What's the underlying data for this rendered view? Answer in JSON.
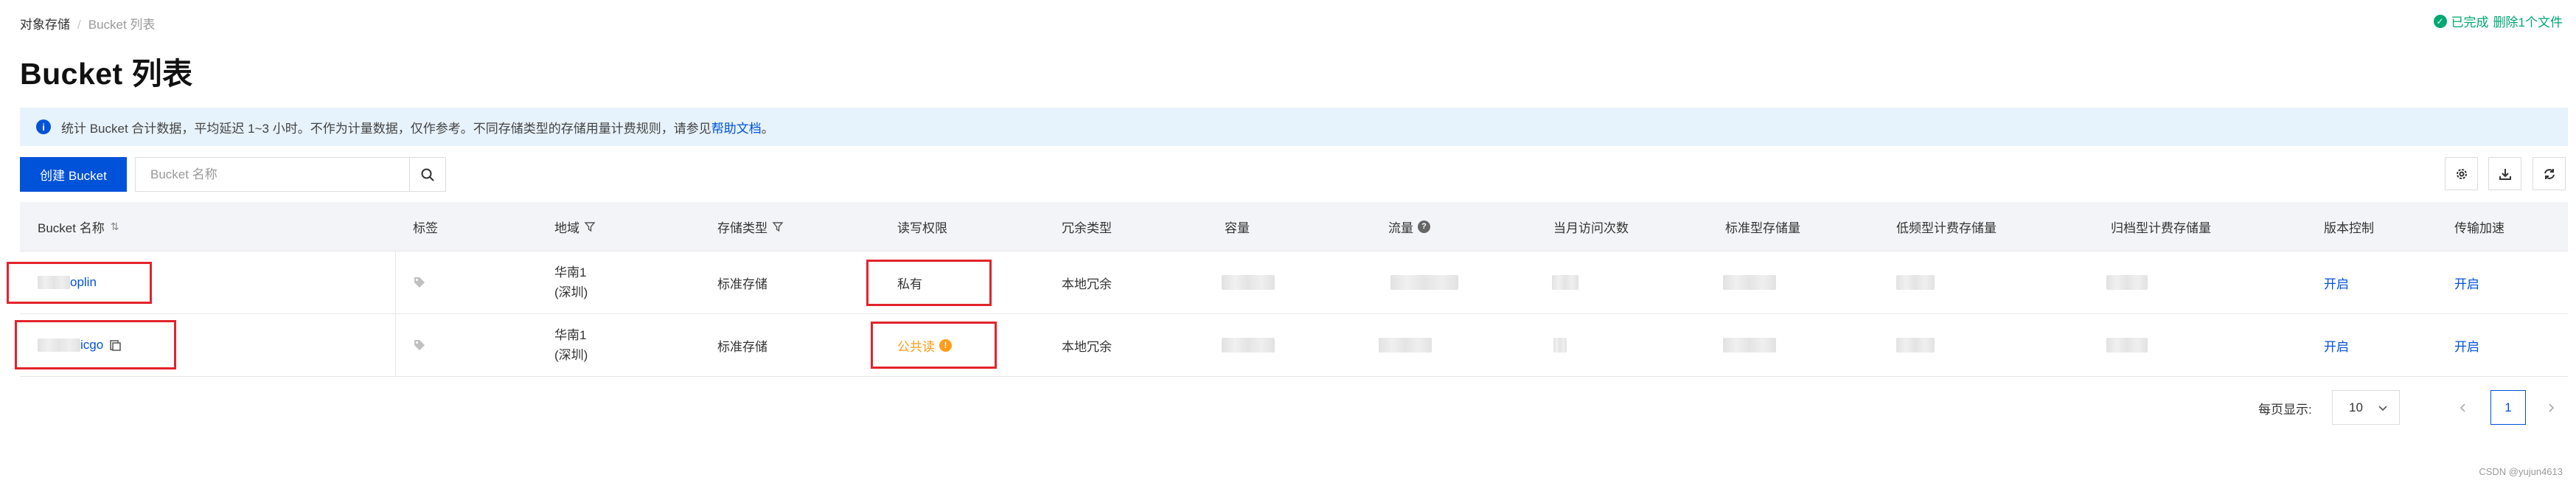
{
  "breadcrumb": {
    "root": "对象存储",
    "separator": "/",
    "current": "Bucket 列表"
  },
  "status": {
    "check": "✓",
    "done": "已完成",
    "detail": "删除1个文件"
  },
  "page_title": "Bucket 列表",
  "notice": {
    "text": "统计 Bucket 合计数据，平均延迟 1~3 小时。不作为计量数据，仅作参考。不同存储类型的存储用量计费规则，请参见",
    "link": "帮助文档",
    "suffix": "。"
  },
  "toolbar": {
    "create_label": "创建 Bucket",
    "search_placeholder": "Bucket 名称"
  },
  "columns": {
    "name": "Bucket 名称",
    "tags": "标签",
    "region": "地域",
    "storage_type": "存储类型",
    "acl": "读写权限",
    "redundancy": "冗余类型",
    "capacity": "容量",
    "traffic": "流量",
    "monthly_visits": "当月访问次数",
    "standard": "标准型存储量",
    "infrequent": "低频型计费存储量",
    "archive": "归档型计费存储量",
    "versioning": "版本控制",
    "acceleration": "传输加速"
  },
  "rows": [
    {
      "name_suffix": "oplin",
      "region_line1": "华南1",
      "region_line2": "(深圳)",
      "storage_type": "标准存储",
      "acl": "私有",
      "redundancy": "本地冗余",
      "versioning": "开启",
      "acceleration": "开启"
    },
    {
      "name_suffix": "icgo",
      "region_line1": "华南1",
      "region_line2": "(深圳)",
      "storage_type": "标准存储",
      "acl": "公共读",
      "redundancy": "本地冗余",
      "versioning": "开启",
      "acceleration": "开启"
    }
  ],
  "pagination": {
    "page_size_label": "每页显示:",
    "page_size": "10",
    "current_page": "1"
  },
  "watermark": "CSDN @yujun4613",
  "colors": {
    "primary": "#0052d9",
    "warning": "#ff9c19",
    "success": "#00a870",
    "highlight": "#e3232c"
  }
}
